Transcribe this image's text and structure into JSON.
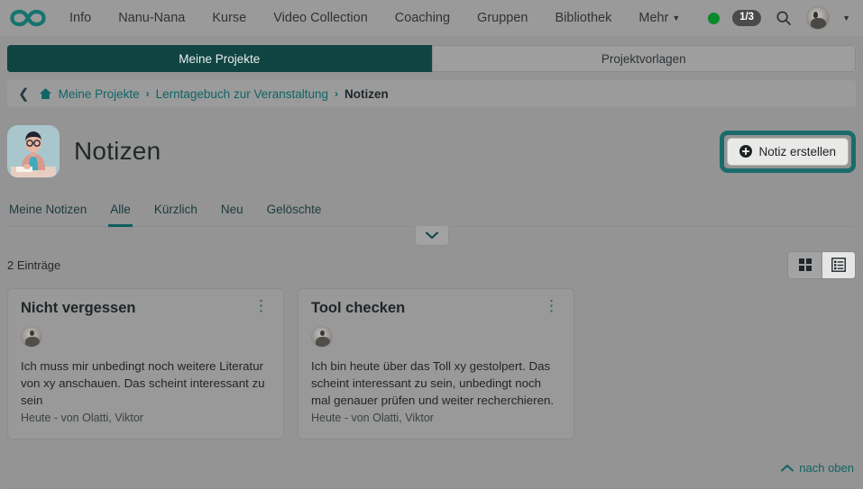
{
  "topnav": {
    "logo_icon": "infinity-logo",
    "links": [
      {
        "label": "Info"
      },
      {
        "label": "Nanu-Nana"
      },
      {
        "label": "Kurse"
      },
      {
        "label": "Video Collection"
      },
      {
        "label": "Coaching"
      },
      {
        "label": "Gruppen"
      },
      {
        "label": "Bibliothek"
      },
      {
        "label": "Mehr"
      }
    ],
    "more_label": "Mehr",
    "status_dot_color": "#0a8a2a",
    "progress_badge": "1/3",
    "search_icon": "search-icon",
    "avatar_icon": "user-avatar",
    "account_caret": "chevron-down-icon"
  },
  "project_tabs": [
    {
      "label": "Meine Projekte",
      "active": true
    },
    {
      "label": "Projektvorlagen",
      "active": false
    }
  ],
  "breadcrumb": {
    "back_icon": "chevron-left-icon",
    "home_icon": "home-icon",
    "items": [
      {
        "label": "Meine Projekte",
        "current": false
      },
      {
        "label": "Lerntagebuch zur Veranstaltung",
        "current": false
      },
      {
        "label": "Notizen",
        "current": true
      }
    ],
    "separator": "›"
  },
  "header": {
    "avatar_icon": "notes-illustration-avatar",
    "title": "Notizen",
    "create_button": {
      "label": "Notiz erstellen",
      "icon": "plus-circle-icon",
      "focus_ring_color": "#1b6b6b"
    }
  },
  "filter_tabs": [
    {
      "label": "Meine Notizen",
      "active": false
    },
    {
      "label": "Alle",
      "active": true
    },
    {
      "label": "Kürzlich",
      "active": false
    },
    {
      "label": "Neu",
      "active": false
    },
    {
      "label": "Gelöschte",
      "active": false
    }
  ],
  "expander": {
    "icon": "chevron-down-icon"
  },
  "listbar": {
    "count_text": "2 Einträge",
    "view_modes": [
      {
        "name": "grid-view",
        "icon": "grid-icon",
        "active": true
      },
      {
        "name": "list-view",
        "icon": "list-icon",
        "active": false
      }
    ]
  },
  "notes": [
    {
      "title": "Nicht vergessen",
      "menu_icon": "kebab-menu-icon",
      "avatar_icon": "user-avatar",
      "body": "Ich muss mir unbedingt noch weitere Literatur von xy anschauen. Das scheint interessant zu sein",
      "meta": "Heute - von Olatti, Viktor"
    },
    {
      "title": "Tool checken",
      "menu_icon": "kebab-menu-icon",
      "avatar_icon": "user-avatar",
      "body": "Ich bin heute über das Toll xy gestolpert. Das scheint interessant zu sein, unbedingt noch mal genauer prüfen und weiter recherchieren.",
      "meta": "Heute - von Olatti, Viktor"
    }
  ],
  "footer": {
    "back_to_top_label": "nach oben",
    "icon": "chevron-up-icon"
  },
  "colors": {
    "accent_teal": "#0f6466",
    "active_tab_bg": "#104442",
    "overlay_gray": "#949494",
    "status_green": "#0a8a2a"
  }
}
